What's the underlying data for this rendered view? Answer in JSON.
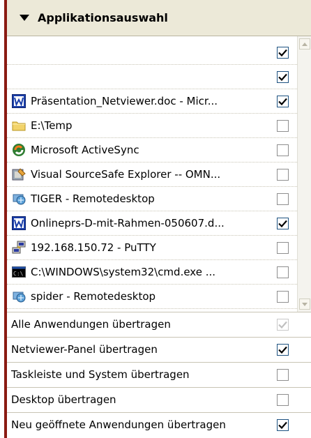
{
  "panel": {
    "title": "Applikationsauswahl"
  },
  "apps": [
    {
      "label": "",
      "icon": "none",
      "checked": true
    },
    {
      "label": "",
      "icon": "none",
      "checked": true
    },
    {
      "label": "Präsentation_Netviewer.doc - Micr...",
      "icon": "word-doc-icon",
      "checked": true
    },
    {
      "label": "E:\\Temp",
      "icon": "folder-icon",
      "checked": false
    },
    {
      "label": "Microsoft ActiveSync",
      "icon": "activesync-icon",
      "checked": false
    },
    {
      "label": "Visual SourceSafe Explorer -- OMN...",
      "icon": "sourcesafe-icon",
      "checked": false
    },
    {
      "label": "TIGER - Remotedesktop",
      "icon": "remote-desktop-icon",
      "checked": false
    },
    {
      "label": "Onlineprs-D-mit-Rahmen-050607.d...",
      "icon": "word-doc-icon",
      "checked": true
    },
    {
      "label": "192.168.150.72 - PuTTY",
      "icon": "putty-icon",
      "checked": false
    },
    {
      "label": "C:\\WINDOWS\\system32\\cmd.exe ...",
      "icon": "cmd-icon",
      "checked": false
    },
    {
      "label": "spider - Remotedesktop",
      "icon": "remote-desktop-icon",
      "checked": false
    }
  ],
  "options": [
    {
      "label": "Alle Anwendungen übertragen",
      "checked": true,
      "disabled": true
    },
    {
      "label": "Netviewer-Panel übertragen",
      "checked": true,
      "disabled": false
    },
    {
      "label": "Taskleiste und System übertragen",
      "checked": false,
      "disabled": false
    },
    {
      "label": "Desktop übertragen",
      "checked": false,
      "disabled": false
    },
    {
      "label": "Neu geöffnete Anwendungen übertragen",
      "checked": true,
      "disabled": false
    }
  ],
  "colors": {
    "accent_border": "#8a1b12",
    "checkbox_border": "#1c5180",
    "header_bg": "#ece9d8"
  }
}
